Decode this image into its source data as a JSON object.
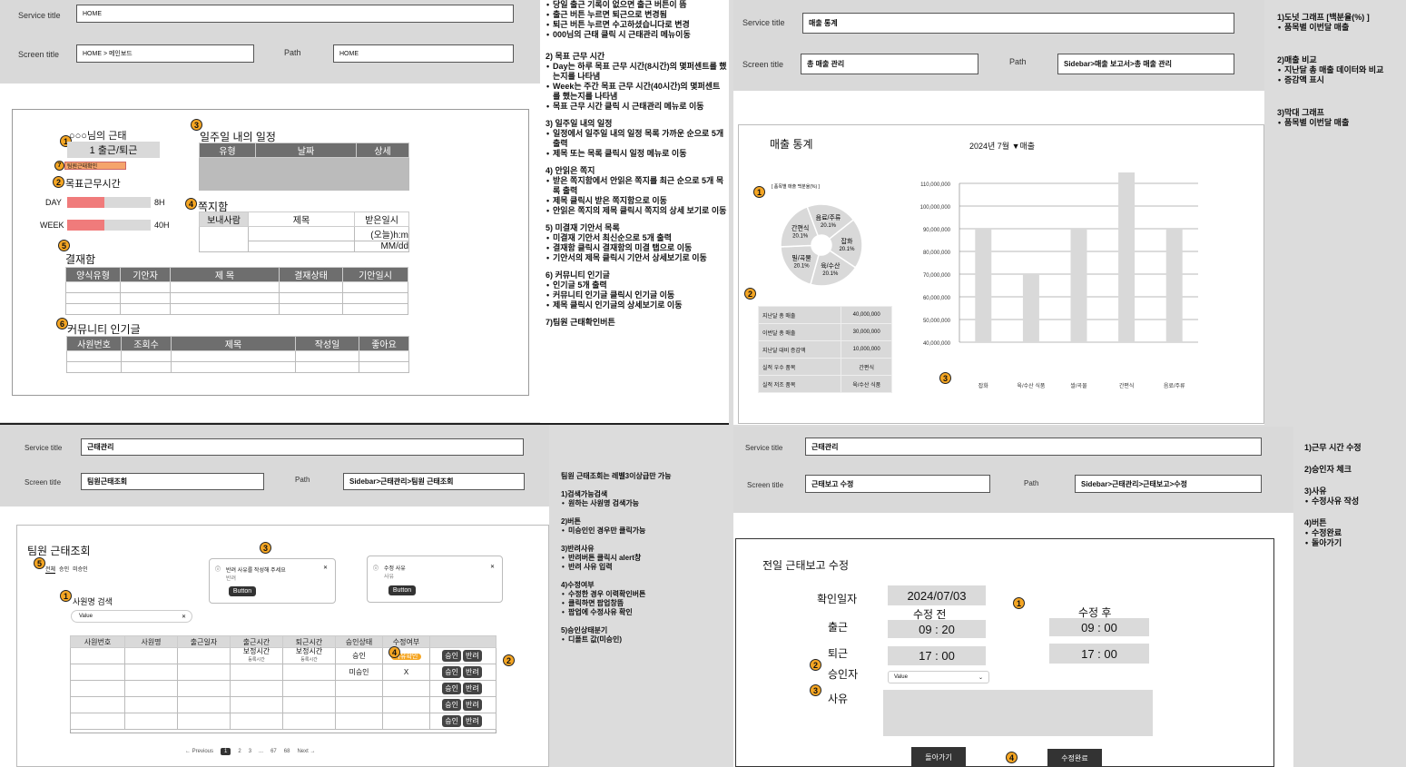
{
  "common": {
    "service_label": "Service title",
    "screen_label": "Screen title",
    "path_label": "Path"
  },
  "p1": {
    "service": "HOME",
    "screen": "HOME > 메인보드",
    "path": "HOME",
    "greeting": "○○○님의 근태",
    "checkin": "1  출근/퇴근",
    "team_btn": "팀원근태확인",
    "goal": "목표근무시간",
    "day_label": "DAY",
    "day_val": "8H",
    "day_fill": 0.45,
    "week_label": "WEEK",
    "week_val": "40H",
    "week_fill": 0.45,
    "sched_title": "일주일 내의 일정",
    "sched_cols": [
      "유형",
      "날짜",
      "상세"
    ],
    "msg_title": "쪽지함",
    "msg_cols": [
      "보내사람",
      "제목",
      "받은일시"
    ],
    "msg_v1": "(오늘)h:m",
    "msg_v2": "MM/dd",
    "appr_title": "결재함",
    "appr_cols": [
      "양식유형",
      "기안자",
      "제 목",
      "결재상태",
      "기안일시"
    ],
    "comm_title": "커뮤니티 인기글",
    "comm_cols": [
      "사원번호",
      "조회수",
      "제목",
      "작성일",
      "좋아요"
    ]
  },
  "mid": {
    "lines1": [
      "당일 출근 기록이 없으면 출근 버튼이 뜸",
      "출근 버튼 누르면 퇴근으로 변경됨",
      "퇴근 버튼 누르면 수고하셨습니다로 변경",
      "000님의 근태 클릭 시 근태관리 메뉴이동"
    ],
    "h2": "2) 목표 근무 시간",
    "lines2": [
      "Day는 하루 목표 근무 시간(8시간)의 몇퍼센트를 했는지를 나타냄",
      "Week는 주간 목표 근무 시간(40시간)의 몇퍼센트를 했는지를 나타냄",
      "목표 근무 시간 클릭 시 근태관리 메뉴로 이동"
    ],
    "h3": "3) 일주일 내의 일정",
    "lines3": [
      "일정에서 일주일 내의 일정 목록 가까운 순으로 5개 출력",
      "제목 또는 목록 클릭시 일정 메뉴로 이동"
    ],
    "h4": "4) 안읽은 쪽지",
    "lines4": [
      "받은 쪽지함에서 안읽은 쪽지를 최근 순으로 5개 목록 출력",
      "제목 클릭시 받은 쪽지함으로 이동",
      "안읽은 쪽지의 제목 클릭시 쪽지의 상세 보기로 이동"
    ],
    "h5": "5) 미결재 기안서 목록",
    "lines5": [
      "미결재 기안서 최신순으로 5개 출력",
      "결재함 클릭시 결재함의 미결 탭으로 이동",
      "기안서의 제목 클릭시 기안서 상세보기로 이동"
    ],
    "h6": "6) 커뮤니티 인기글",
    "lines6": [
      "인기글 5개 출력",
      "커뮤니티 인기글 클릭시 인기글 이동",
      "제목 클릭시 인기글의 상세보기로 이동"
    ],
    "h7": "7)팀원 근태확인버튼"
  },
  "p2": {
    "service": "매출 통계",
    "screen": "총 매출 관리",
    "path": "Sidebar>매출 보고서>총 매출 관리",
    "title": "매출 통계",
    "period": "2024년 7월 ▼매출",
    "pie_caption": "[ 품목별 매출 백분율(%) ]",
    "stats": [
      [
        "지난달 총 매출",
        "40,000,000"
      ],
      [
        "이번달 총 매출",
        "30,000,000"
      ],
      [
        "지난달 대비 증감액",
        "10,000,000"
      ],
      [
        "실적 우수 품목",
        "간편식"
      ],
      [
        "실적 저조 품목",
        "육/수산 식품"
      ]
    ],
    "notes": {
      "n1": "1)도넛 그래프 [백분율(%) ]",
      "n1a": "품목별 이번달 매출",
      "n2": "2)매출 비교",
      "n2a": "지난달 총 매출 데이터와 비교",
      "n2b": "증감액 표시",
      "n3": "3)막대 그래프",
      "n3a": "품목별 이번달 매출"
    }
  },
  "chart_data": [
    {
      "type": "pie",
      "labels": [
        "잡화",
        "육/수산",
        "밀/곡물",
        "간편식",
        "음료/주류"
      ],
      "values": [
        20.1,
        20.1,
        20.1,
        20.1,
        20.1
      ],
      "value_labels": [
        "20.1%",
        "20.1%",
        "20.1%",
        "20.1%",
        "20.1%"
      ],
      "title": "[ 품목별 매출 백분율(%) ]"
    },
    {
      "type": "bar",
      "categories": [
        "잡화",
        "육/수산 식품",
        "쌀/곡물",
        "간편식",
        "음료/주류"
      ],
      "values": [
        90000000,
        70000000,
        90000000,
        118000000,
        90000000
      ],
      "ylim": [
        40000000,
        110000000
      ],
      "yticks": [
        "110,000,000",
        "100,000,000",
        "90,000,000",
        "80,000,000",
        "70,000,000",
        "60,000,000",
        "50,000,000",
        "40,000,000"
      ]
    }
  ],
  "p3": {
    "service": "근태관리",
    "screen": "팀원근태조회",
    "path": "Sidebar>근태관리>팀원 근태조회",
    "title": "팀원 근태조회",
    "tabs": [
      "전체",
      "승인",
      "미승인"
    ],
    "search_label": "사원명 검색",
    "search_value": "Value",
    "dlg1_title": "반려 사유를 작성해 주세요",
    "dlg1_sub": "반려",
    "dlg1_btn": "Button",
    "dlg2_title": "수정 사유",
    "dlg2_sub": "사유",
    "dlg2_btn": "Button",
    "cols": [
      "사원번호",
      "사원명",
      "출근일자",
      "출근시간",
      "퇴근시간",
      "승인상태",
      "수정여부"
    ],
    "sub_in": "보정시간",
    "sub_in2": "등록시간",
    "sub_out": "보정시간",
    "sub_out2": "등록시간",
    "r1_status": "승인",
    "r1_fix": "사유확인",
    "r2_status": "미승인",
    "r2_fix": "X",
    "approve": "승인",
    "reject": "반려",
    "pages": {
      "prev": "← Previous",
      "p1": "1",
      "p2": "2",
      "p3": "3",
      "dots": "...",
      "p67": "67",
      "p68": "68",
      "next": "Next →"
    },
    "desc_title": "팀원 근태조회는 레벨3이상급만 가능",
    "d1": "1)검색가능검색",
    "d1a": "원하는 사원명 검색가능",
    "d2": "2)버튼",
    "d2a": "미승인인 경우만 클릭가능",
    "d3": "3)반려사유",
    "d3a": "반려버튼 클릭시 alert창",
    "d3b": "반려 사유 입력",
    "d4": "4)수정여부",
    "d4a": "수정한 경우 이력확인버튼",
    "d4b": "클릭하면 팝업창뜸",
    "d4c": "팝업에 수정사유 확인",
    "d5": "5)승인상태분기",
    "d5a": "디폴트 값(미승인)"
  },
  "p4": {
    "service": "근태관리",
    "screen": "근태보고 수정",
    "path": "Sidebar>근태관리>근태보고>수정",
    "title": "전일 근태보고 수정",
    "confirm_label": "확인일자",
    "confirm_val": "2024/07/03",
    "before": "수정 전",
    "after": "수정 후",
    "in_label": "출근",
    "in_before": "09 : 20",
    "in_after": "09 : 00",
    "out_label": "퇴근",
    "out_before": "17 : 00",
    "out_after": "17 : 00",
    "approver_label": "승인자",
    "approver_val": "Value",
    "reason_label": "사유",
    "back_btn": "돌아가기",
    "done_btn": "수정완료",
    "notes": {
      "n1": "1)근무 시간 수정",
      "n2": "2)승인자 체크",
      "n3": "3)사유",
      "n3a": "수정사유 작성",
      "n4": "4)버튼",
      "n4a": "수정완료",
      "n4b": "돌아가기"
    }
  },
  "colors": {
    "accent": "#f5a623",
    "bar_red": "#f07b7b",
    "table_header": "#6e6e6e"
  }
}
